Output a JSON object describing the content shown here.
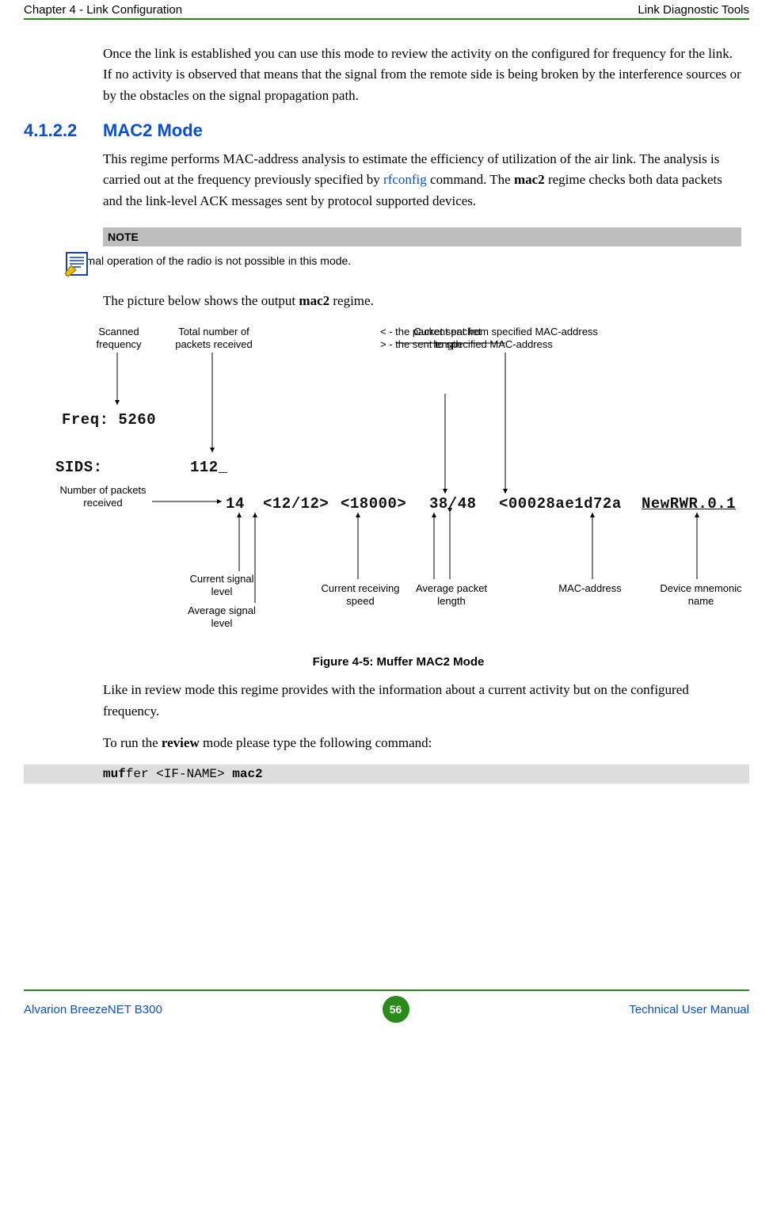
{
  "header": {
    "left": "Chapter 4 - Link Configuration",
    "right": "Link Diagnostic Tools"
  },
  "intro_para": "Once the link is established you can use this mode to review the activity on the configured for frequency for the link. If no activity is observed that means that the signal from the remote side is being broken by the interference sources or by the obstacles on the signal propagation path.",
  "section": {
    "num": "4.1.2.2",
    "title": "MAC2 Mode"
  },
  "body": {
    "p1_pre": "This regime performs MAC-address analysis to estimate the efficiency of utilization of the air link. The analysis is carried out at the frequency previously specified by ",
    "p1_link": "rfconfig",
    "p1_mid": " command. The ",
    "p1_bold": "mac2",
    "p1_post": " regime checks both data packets and the link-level ACK messages sent by protocol supported devices.",
    "p2_pre": "The picture below shows the output ",
    "p2_bold": "mac2",
    "p2_post": " regime.",
    "p3": "Like in review mode this regime provides with the information about a current activity but on the configured frequency.",
    "p4_pre": "To run the ",
    "p4_bold": "review",
    "p4_post": " mode please type the following command:"
  },
  "note": {
    "head": "NOTE",
    "body": "Normal operation of the radio is not possible in this mode."
  },
  "figure": {
    "caption": "Figure 4-5: Muffer MAC2 Mode",
    "labels": {
      "scanned": "Scanned\nfrequency",
      "total_packets": "Total number of\npackets received",
      "pkt_direction": "< - the packet sent from specified MAC-address\n> - the sent to specified MAC-address",
      "cur_pkt_len": "Current packet\nlength",
      "num_pkts": "Number of packets\nreceived",
      "cur_sig": "Current signal\nlevel",
      "avg_sig": "Average signal\nlevel",
      "cur_speed": "Current receiving\nspeed",
      "avg_pkt_len": "Average packet\nlength",
      "mac_addr": "MAC-address",
      "mnemonic": "Device mnemonic\nname"
    },
    "mono": {
      "freq": "Freq: 5260",
      "sids": "SIDS:",
      "count_total": "112_",
      "count_14": "14",
      "ratio": "<12/12>",
      "speed": "<18000>",
      "pktlen": "38/48",
      "mac": "<00028ae1d72a",
      "name": "NewRWR.0.1"
    }
  },
  "command": {
    "prefix_bold": "muf",
    "mid": "fer <IF-NAME> ",
    "suffix_bold": "mac2"
  },
  "footer": {
    "left": "Alvarion BreezeNET B300",
    "page": "56",
    "right": "Technical User Manual"
  }
}
